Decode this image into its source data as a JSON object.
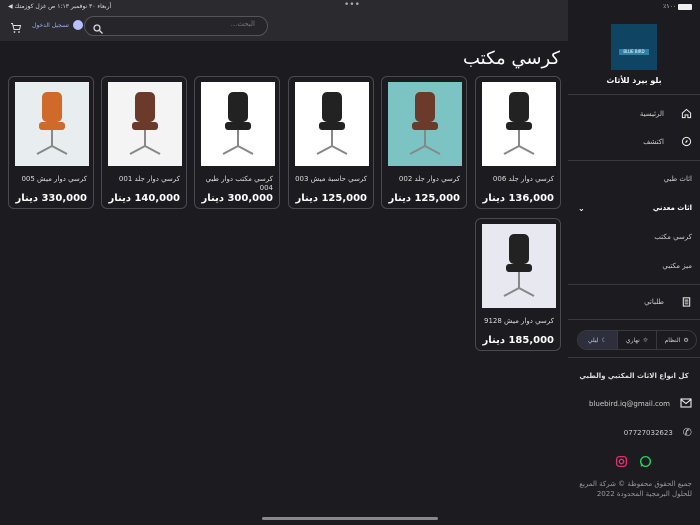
{
  "status": {
    "left": "أربعاء ٣٠ نوفمبر ١:١٣ ص  غزل كوزمتك ◀",
    "battery": "٪١٠٠"
  },
  "topbar": {
    "search_placeholder": "البحث...",
    "login": "تسجيل الدخول"
  },
  "page_title": "كرسي مكتب",
  "products": [
    {
      "name": "كرسي دوار جلد 006",
      "price": "136,000 دينار"
    },
    {
      "name": "كرسي دوار جلد 002",
      "price": "125,000 دينار"
    },
    {
      "name": "كرسي حاسبة ميش 003",
      "price": "125,000 دينار"
    },
    {
      "name": "كرسي مكتب دوار طبي 004",
      "price": "300,000 دينار"
    },
    {
      "name": "كرسي دوار جلد 001",
      "price": "140,000 دينار"
    },
    {
      "name": "كرسي دوار ميش 005",
      "price": "330,000 دينار"
    },
    {
      "name": "كرسي دوار ميش 9128",
      "price": "185,000 دينار"
    }
  ],
  "sidebar": {
    "logo_text": "BLUE BIRD",
    "brand": "بلو بيرد للأثاث",
    "home": "الرئيسية",
    "explore": "اكتشف",
    "medical": "اثاث طبي",
    "metal": "اثاث معدني",
    "office_chair": "كرسي مكتب",
    "office_desk": "ميز مكتبي",
    "orders": "طلباتي",
    "theme": {
      "system": "النظام",
      "light": "نهاري",
      "dark": "ليلي"
    },
    "slogan": "كل انواع الاثاث المكتبي والطبي",
    "email": "bluebird.iq@gmail.com",
    "phone": "07727032623",
    "copyright": "جميع الحقوق محفوظة © شركة المربع للحلول البرمجية المحدودة 2022"
  },
  "colors": {
    "accent": "#b8c0ff",
    "whatsapp": "#25d366",
    "instagram": "#e1306c"
  }
}
